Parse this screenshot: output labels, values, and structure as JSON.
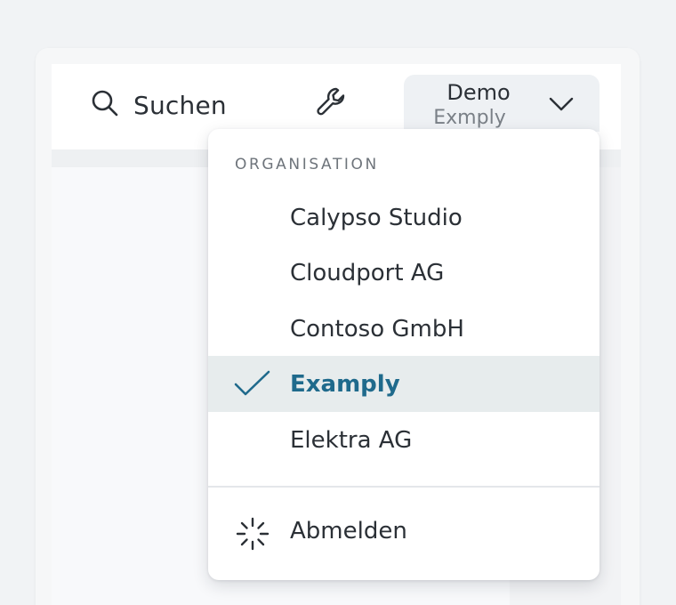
{
  "header": {
    "search_label": "Suchen",
    "search_icon": "search-icon",
    "tools_icon": "wrench-icon"
  },
  "org_switcher": {
    "current_user": "Demo",
    "current_org": "Exmply"
  },
  "menu": {
    "heading": "ORGANISATION",
    "items": [
      {
        "label": "Calypso Studio",
        "selected": false
      },
      {
        "label": "Cloudport AG",
        "selected": false
      },
      {
        "label": "Contoso GmbH",
        "selected": false
      },
      {
        "label": "Examply",
        "selected": true
      },
      {
        "label": "Elektra AG",
        "selected": false
      }
    ],
    "logout_label": "Abmelden",
    "logout_icon": "spinner-icon"
  },
  "colors": {
    "selected_text": "#1f6a8c",
    "selected_bg": "#e7eced",
    "page_bg": "#f1f3f5"
  }
}
